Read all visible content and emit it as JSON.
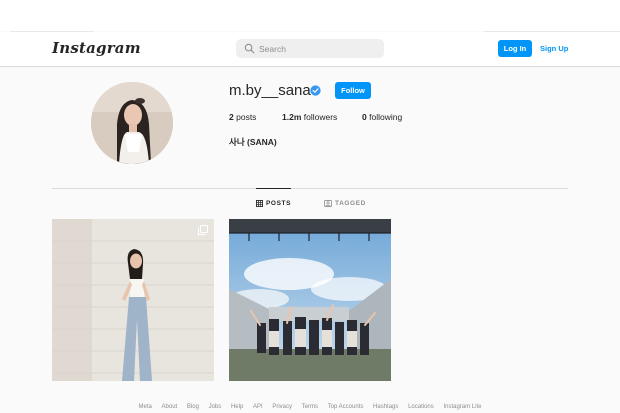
{
  "nav": {
    "logo": "Instagram",
    "search_placeholder": "Search",
    "login_label": "Log In",
    "signup_label": "Sign Up"
  },
  "profile": {
    "username": "m.by__sana",
    "verified": true,
    "follow_label": "Follow",
    "posts_count": "2",
    "posts_label": "posts",
    "followers_count": "1.2m",
    "followers_label": "followers",
    "following_count": "0",
    "following_label": "following",
    "full_name": "사나 (SANA)"
  },
  "tabs": [
    {
      "label": "POSTS",
      "icon": "grid-icon",
      "active": true
    },
    {
      "label": "TAGGED",
      "icon": "tag-icon",
      "active": false
    }
  ],
  "posts": [
    {
      "subject": "photo-woman-posing",
      "multi_image": true
    },
    {
      "subject": "photo-stadium-group",
      "multi_image": false
    }
  ],
  "footer": {
    "links": [
      "Meta",
      "About",
      "Blog",
      "Jobs",
      "Help",
      "API",
      "Privacy",
      "Terms",
      "Top Accounts",
      "Hashtags",
      "Locations",
      "Instagram Lite"
    ]
  },
  "colors": {
    "accent": "#0095f6",
    "text": "#262626",
    "muted": "#8e8e8e",
    "background": "#fafafa"
  }
}
